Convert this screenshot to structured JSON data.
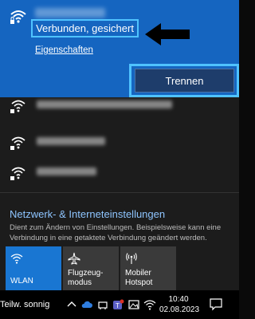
{
  "connected_network": {
    "status": "Verbunden, gesichert",
    "properties_link": "Eigenschaften",
    "disconnect_label": "Trennen"
  },
  "network_settings": {
    "title": "Netzwerk- & Interneteinstellungen",
    "description": "Dient zum Ändern von Einstellungen. Beispielsweise kann eine Verbindung in eine getaktete Verbindung geändert werden."
  },
  "quick_actions": {
    "wlan": "WLAN",
    "flight_mode": "Flugzeug-",
    "flight_mode_2": "modus",
    "hotspot": "Mobiler",
    "hotspot_2": "Hotspot"
  },
  "taskbar": {
    "weather": "Teilw. sonnig",
    "time": "10:40",
    "date": "02.08.2023"
  },
  "colors": {
    "accent": "#1565c0",
    "highlight": "#4fc3ff",
    "link": "#8ec5ff"
  }
}
